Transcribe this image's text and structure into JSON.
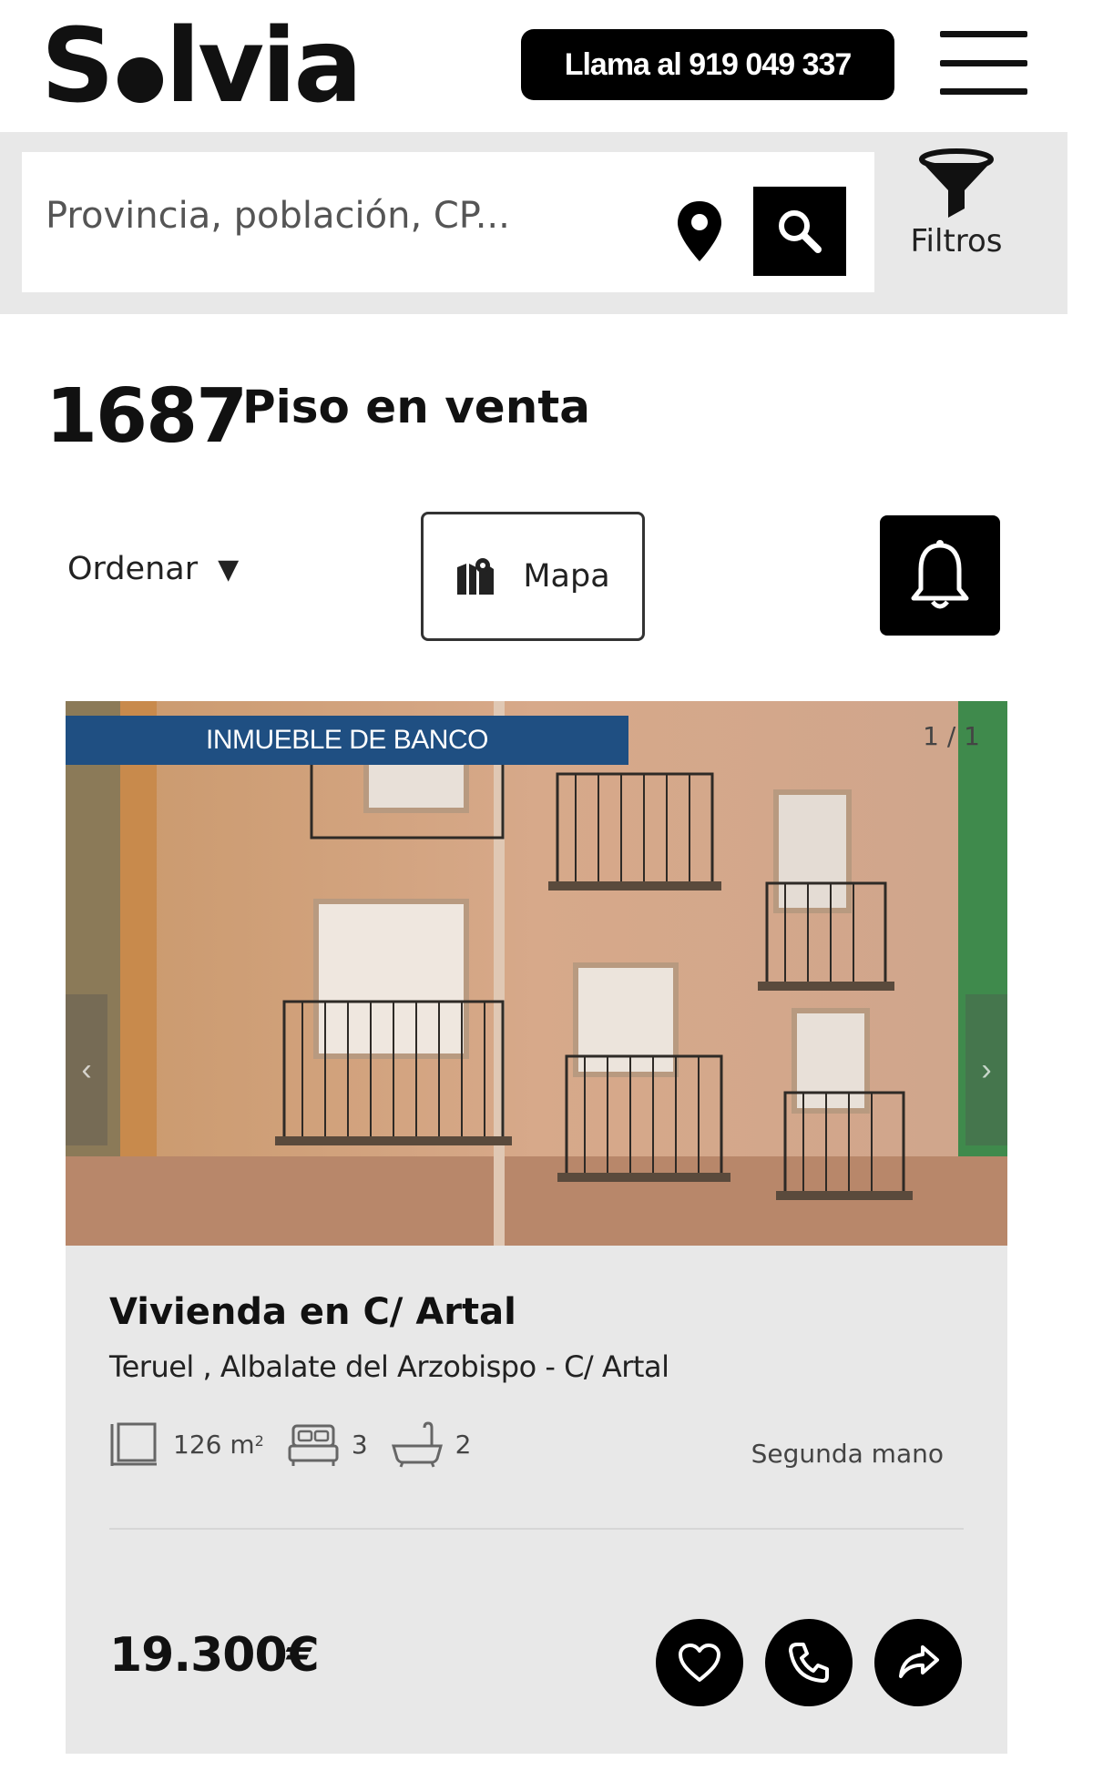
{
  "header": {
    "logo_text": "Solvia",
    "call_label": "Llama al 919 049 337"
  },
  "search": {
    "placeholder": "Provincia, población, CP...",
    "value": "",
    "filter_label": "Filtros"
  },
  "results": {
    "count": "1687",
    "title": "Piso en venta"
  },
  "toolbar": {
    "sort_label": "Ordenar",
    "map_label": "Mapa"
  },
  "listing": {
    "badge": "INMUEBLE DE BANCO",
    "photo_counter": "1 / 1",
    "title": "Vivienda en C/ Artal",
    "address": "Teruel , Albalate del Arzobispo - C/ Artal",
    "area_value": "126 m",
    "area_sup": "2",
    "bedrooms": "3",
    "bathrooms": "2",
    "condition": "Segunda mano",
    "price": "19.300€"
  },
  "icons": [
    "location-pin-icon",
    "search-icon",
    "filter-funnel-icon",
    "map-icon",
    "bell-icon",
    "area-icon",
    "bed-icon",
    "bath-icon",
    "heart-icon",
    "phone-icon",
    "share-icon"
  ],
  "colors": {
    "badge_blue": "#1f4f82",
    "band_gray": "#e8e8e8",
    "black": "#000000"
  }
}
